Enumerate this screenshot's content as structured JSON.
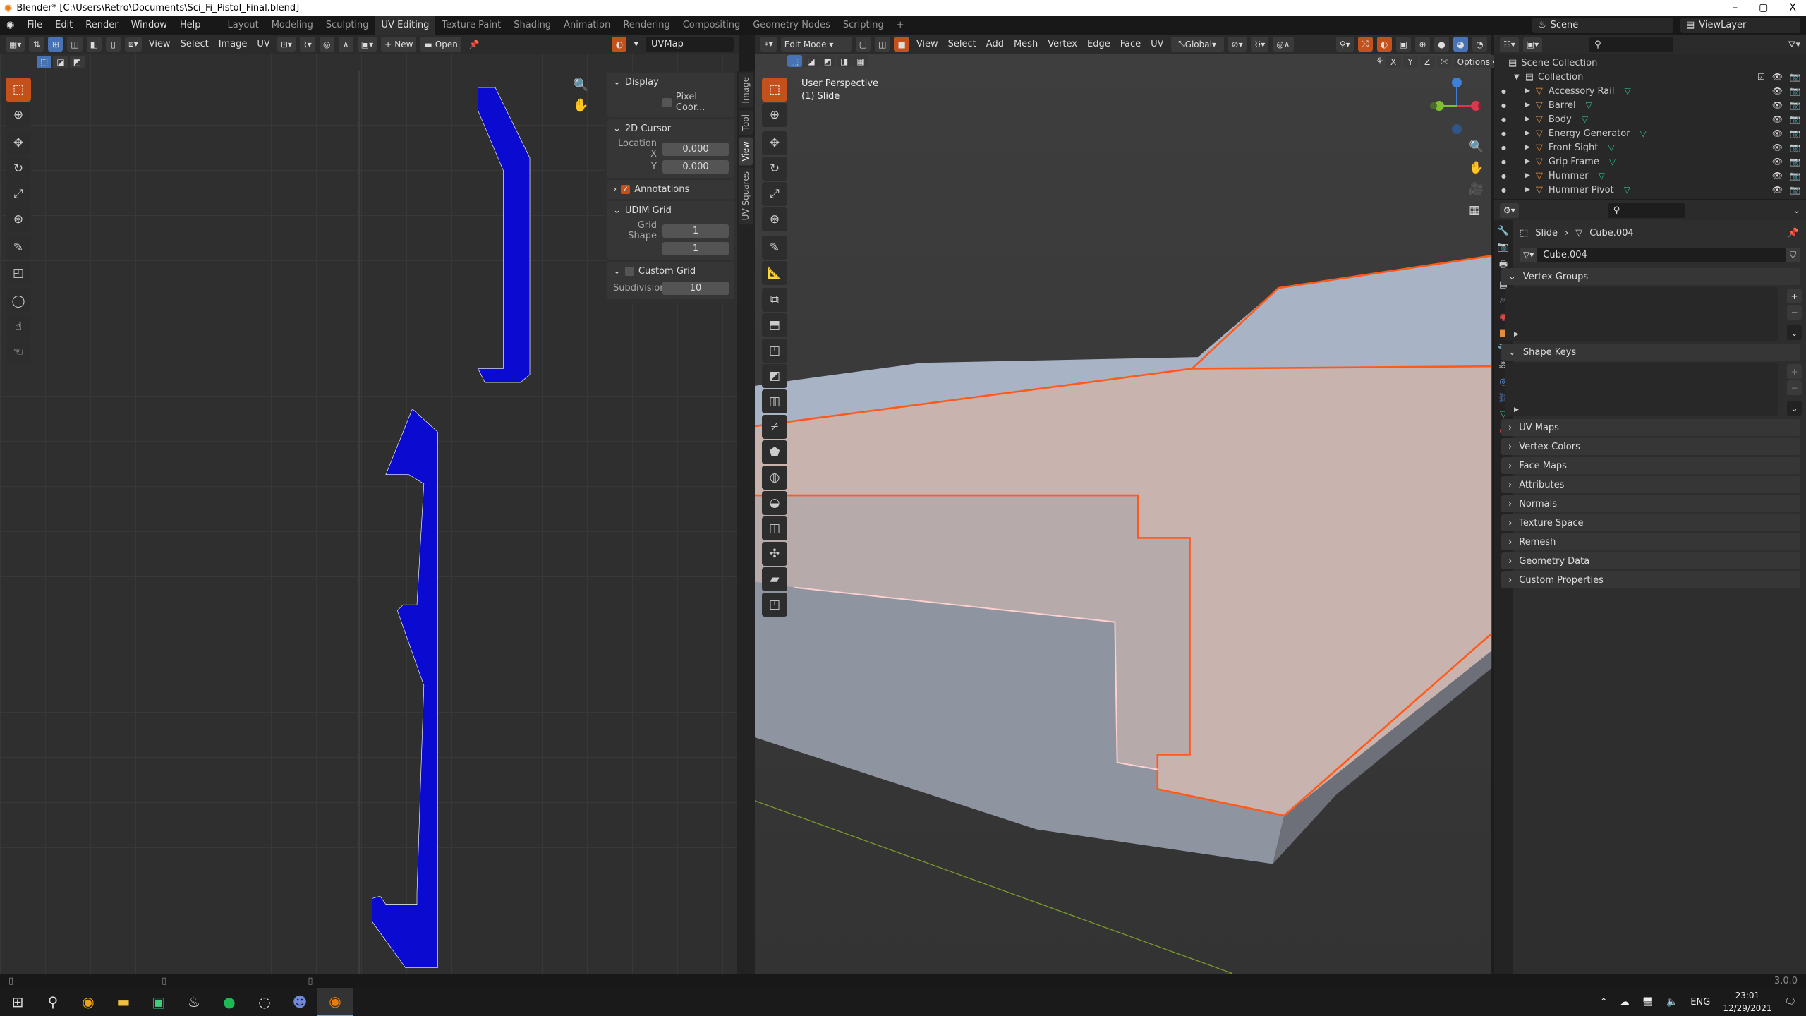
{
  "window": {
    "title": "Blender* [C:\\Users\\Retro\\Documents\\Sci_Fi_Pistol_Final.blend]",
    "minimize": "–",
    "maximize": "▢",
    "close": "X"
  },
  "menu": [
    "File",
    "Edit",
    "Render",
    "Window",
    "Help"
  ],
  "workspaces": [
    {
      "label": "Layout"
    },
    {
      "label": "Modeling"
    },
    {
      "label": "Sculpting"
    },
    {
      "label": "UV Editing",
      "active": true
    },
    {
      "label": "Texture Paint"
    },
    {
      "label": "Shading"
    },
    {
      "label": "Animation"
    },
    {
      "label": "Rendering"
    },
    {
      "label": "Compositing"
    },
    {
      "label": "Geometry Nodes"
    },
    {
      "label": "Scripting"
    },
    {
      "label": "+"
    }
  ],
  "scene": {
    "scene_name": "Scene",
    "view_layer": "ViewLayer"
  },
  "uv_editor": {
    "header": {
      "menus": [
        "View",
        "Select",
        "Image",
        "UV"
      ],
      "new_label": "New",
      "open_label": "Open",
      "uvmap": "UVMap"
    },
    "sidebar": {
      "tabs": [
        "Image",
        "Tool",
        "View",
        "UV Squares"
      ],
      "active_tab": "View",
      "display": {
        "title": "Display",
        "pixel_coords": "Pixel Coor...",
        "pixel_checked": false
      },
      "cursor": {
        "title": "2D Cursor",
        "location_x_label": "Location X",
        "y_label": "Y",
        "x": "0.000",
        "y": "0.000"
      },
      "annotations": {
        "title": "Annotations",
        "checked": true
      },
      "udim": {
        "title": "UDIM Grid",
        "grid_shape_label": "Grid Shape",
        "a": "1",
        "b": "1"
      },
      "custom_grid": {
        "title": "Custom Grid",
        "checked": false,
        "subdivisions_label": "Subdivisions",
        "subdivisions": "10"
      }
    },
    "uv_color": "#0a0ad0"
  },
  "viewport": {
    "header": {
      "mode": "Edit Mode",
      "menus": [
        "View",
        "Select",
        "Add",
        "Mesh",
        "Vertex",
        "Edge",
        "Face",
        "UV"
      ],
      "orientation": "Global",
      "options": "Options",
      "axes": [
        "X",
        "Y",
        "Z"
      ]
    },
    "overlay": {
      "view_name": "User Perspective",
      "object": "(1) Slide"
    },
    "edge_color": "#ff5a1a"
  },
  "outliner": {
    "root": "Scene Collection",
    "collection": "Collection",
    "items": [
      "Accessory Rail",
      "Barrel",
      "Body",
      "Energy Generator",
      "Front Sight",
      "Grip Frame",
      "Hummer",
      "Hummer Pivot"
    ]
  },
  "properties": {
    "breadcrumb": {
      "object": "Slide",
      "mesh": "Cube.004"
    },
    "mesh_name": "Cube.004",
    "panels_open": [
      "Vertex Groups",
      "Shape Keys"
    ],
    "panels_closed": [
      "UV Maps",
      "Vertex Colors",
      "Face Maps",
      "Attributes",
      "Normals",
      "Texture Space",
      "Remesh",
      "Geometry Data",
      "Custom Properties"
    ]
  },
  "status": {
    "version": "3.0.0"
  },
  "taskbar": {
    "lang": "ENG",
    "time": "23:01",
    "date": "12/29/2021"
  }
}
